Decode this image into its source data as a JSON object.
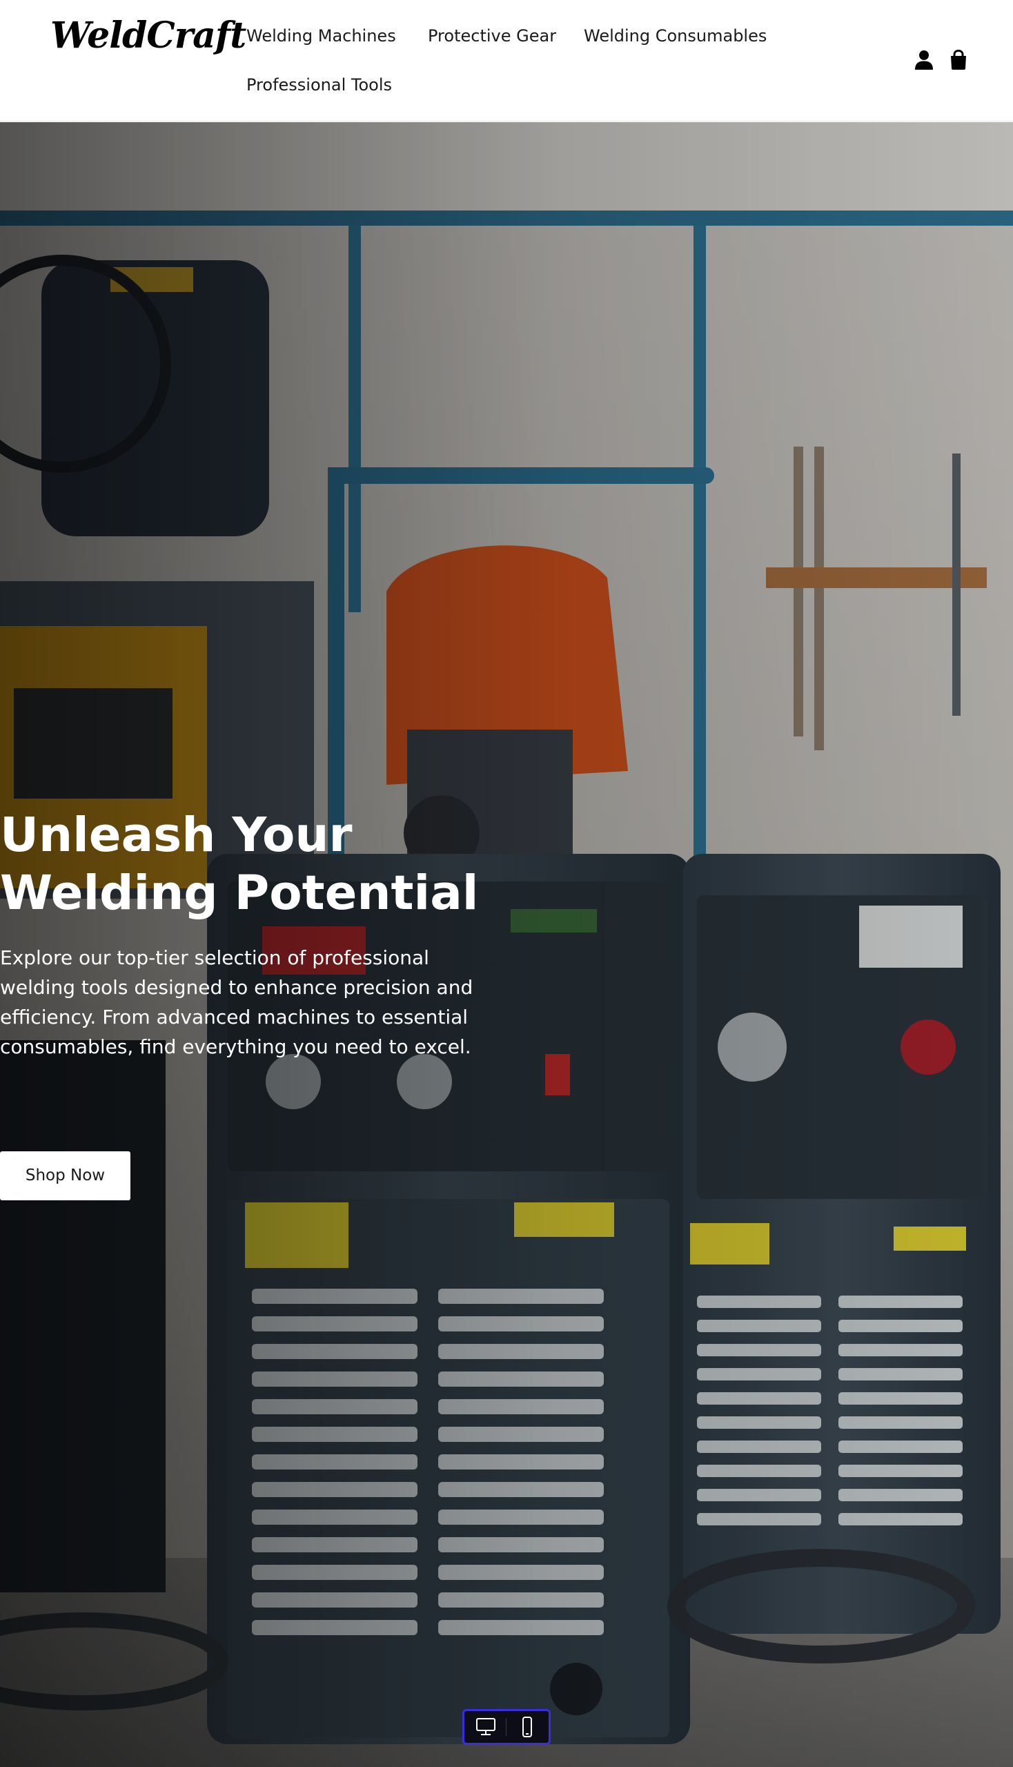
{
  "brand": {
    "name": "WeldCraft"
  },
  "nav": {
    "items": [
      {
        "label": "Welding Machines"
      },
      {
        "label": "Protective Gear"
      },
      {
        "label": "Welding Consumables"
      },
      {
        "label": "Professional Tools"
      }
    ]
  },
  "header_icons": {
    "account": "user-icon",
    "cart": "shopping-bag-icon"
  },
  "hero": {
    "title_line_1": "Unleash Your",
    "title_line_2": "Welding Potential",
    "description": "Explore our top-tier selection of professional welding tools designed to enhance precision and efficiency. From advanced machines to essential consumables, find everything you need to excel.",
    "cta_label": "Shop Now",
    "background_image": "welding-machines-workshop-photo"
  },
  "device_toggle": {
    "options": [
      "desktop-icon",
      "mobile-icon"
    ],
    "border_color": "#3a2fe0"
  },
  "colors": {
    "header_bg": "#ffffff",
    "text_primary": "#1a1a1a",
    "hero_text": "#ffffff",
    "button_bg": "#ffffff"
  }
}
